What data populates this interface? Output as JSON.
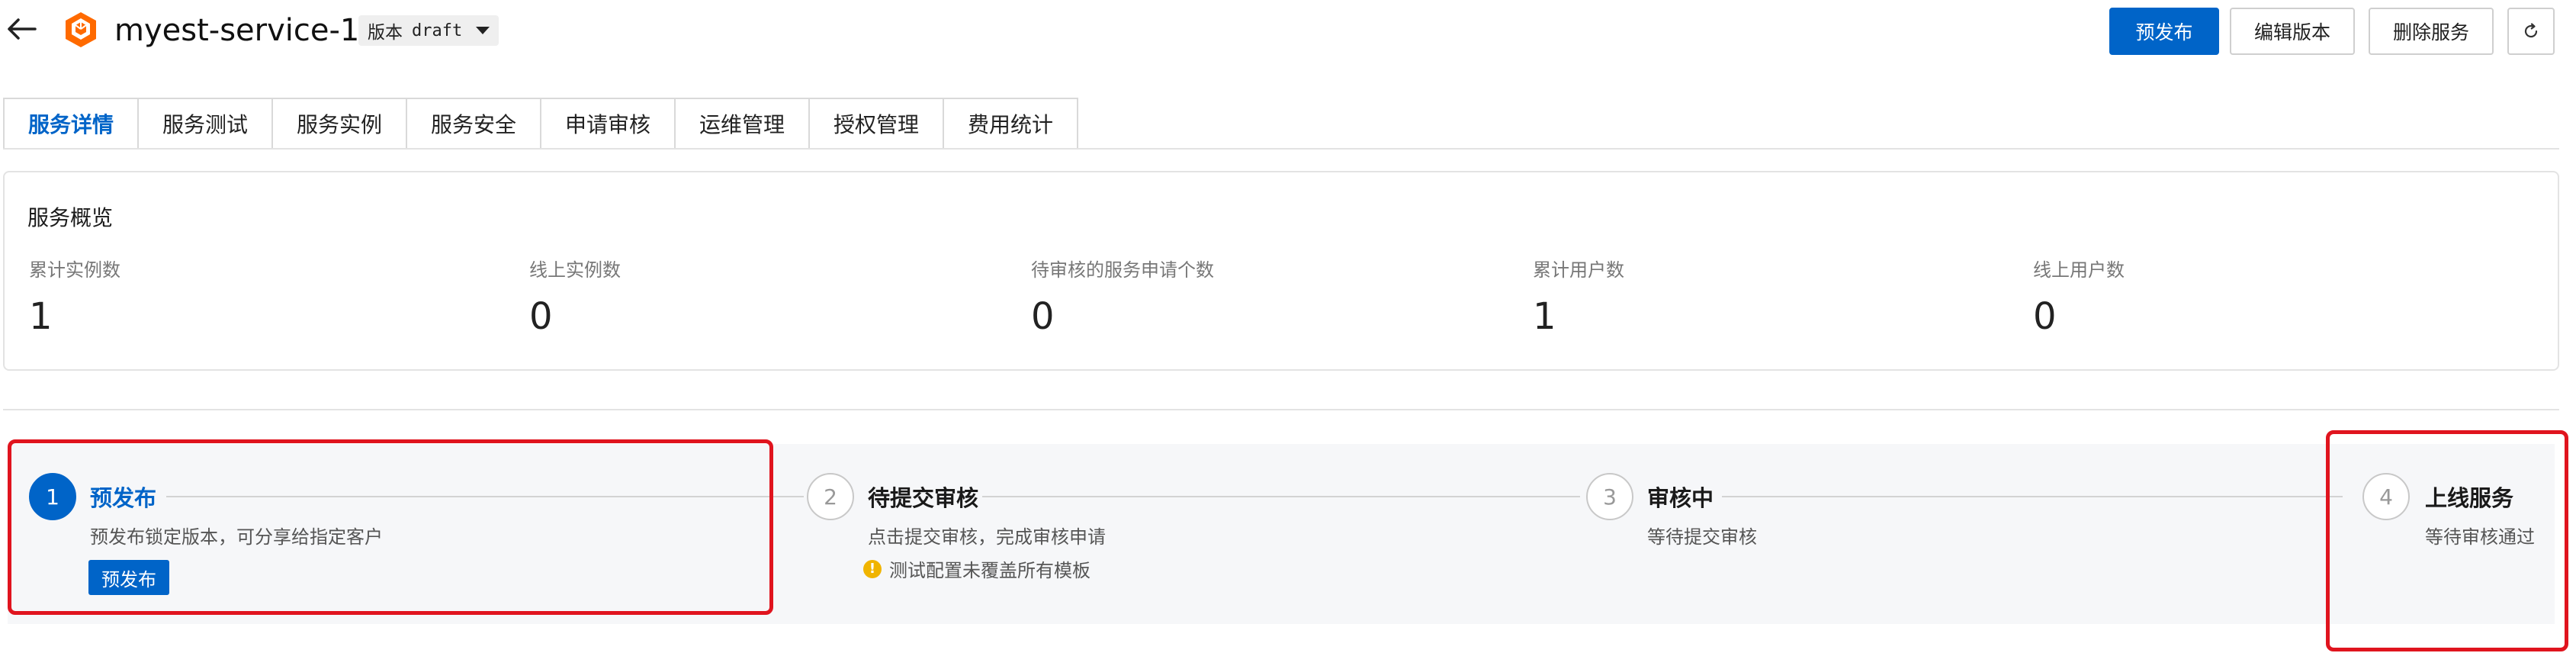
{
  "header": {
    "title": "myest-service-1",
    "version_label": "版本",
    "version_value": "draft",
    "buttons": {
      "publish": "预发布",
      "edit": "编辑版本",
      "delete": "删除服务"
    }
  },
  "tabs": [
    {
      "label": "服务详情",
      "active": true
    },
    {
      "label": "服务测试"
    },
    {
      "label": "服务实例"
    },
    {
      "label": "服务安全"
    },
    {
      "label": "申请审核"
    },
    {
      "label": "运维管理"
    },
    {
      "label": "授权管理"
    },
    {
      "label": "费用统计"
    }
  ],
  "overview": {
    "title": "服务概览",
    "metrics": [
      {
        "label": "累计实例数",
        "value": "1"
      },
      {
        "label": "线上实例数",
        "value": "0"
      },
      {
        "label": "待审核的服务申请个数",
        "value": "0"
      },
      {
        "label": "累计用户数",
        "value": "1"
      },
      {
        "label": "线上用户数",
        "value": "0"
      }
    ]
  },
  "steps": [
    {
      "num": "1",
      "title": "预发布",
      "desc": "预发布锁定版本，可分享给指定客户",
      "action": "预发布",
      "active": true
    },
    {
      "num": "2",
      "title": "待提交审核",
      "desc": "点击提交审核，完成审核申请",
      "warning": "测试配置未覆盖所有模板"
    },
    {
      "num": "3",
      "title": "审核中",
      "desc": "等待提交审核"
    },
    {
      "num": "4",
      "title": "上线服务",
      "desc": "等待审核通过"
    }
  ],
  "colors": {
    "primary": "#0064c8",
    "highlight": "#e0141e",
    "warning": "#f0b400",
    "logo": "#ff6a00"
  }
}
